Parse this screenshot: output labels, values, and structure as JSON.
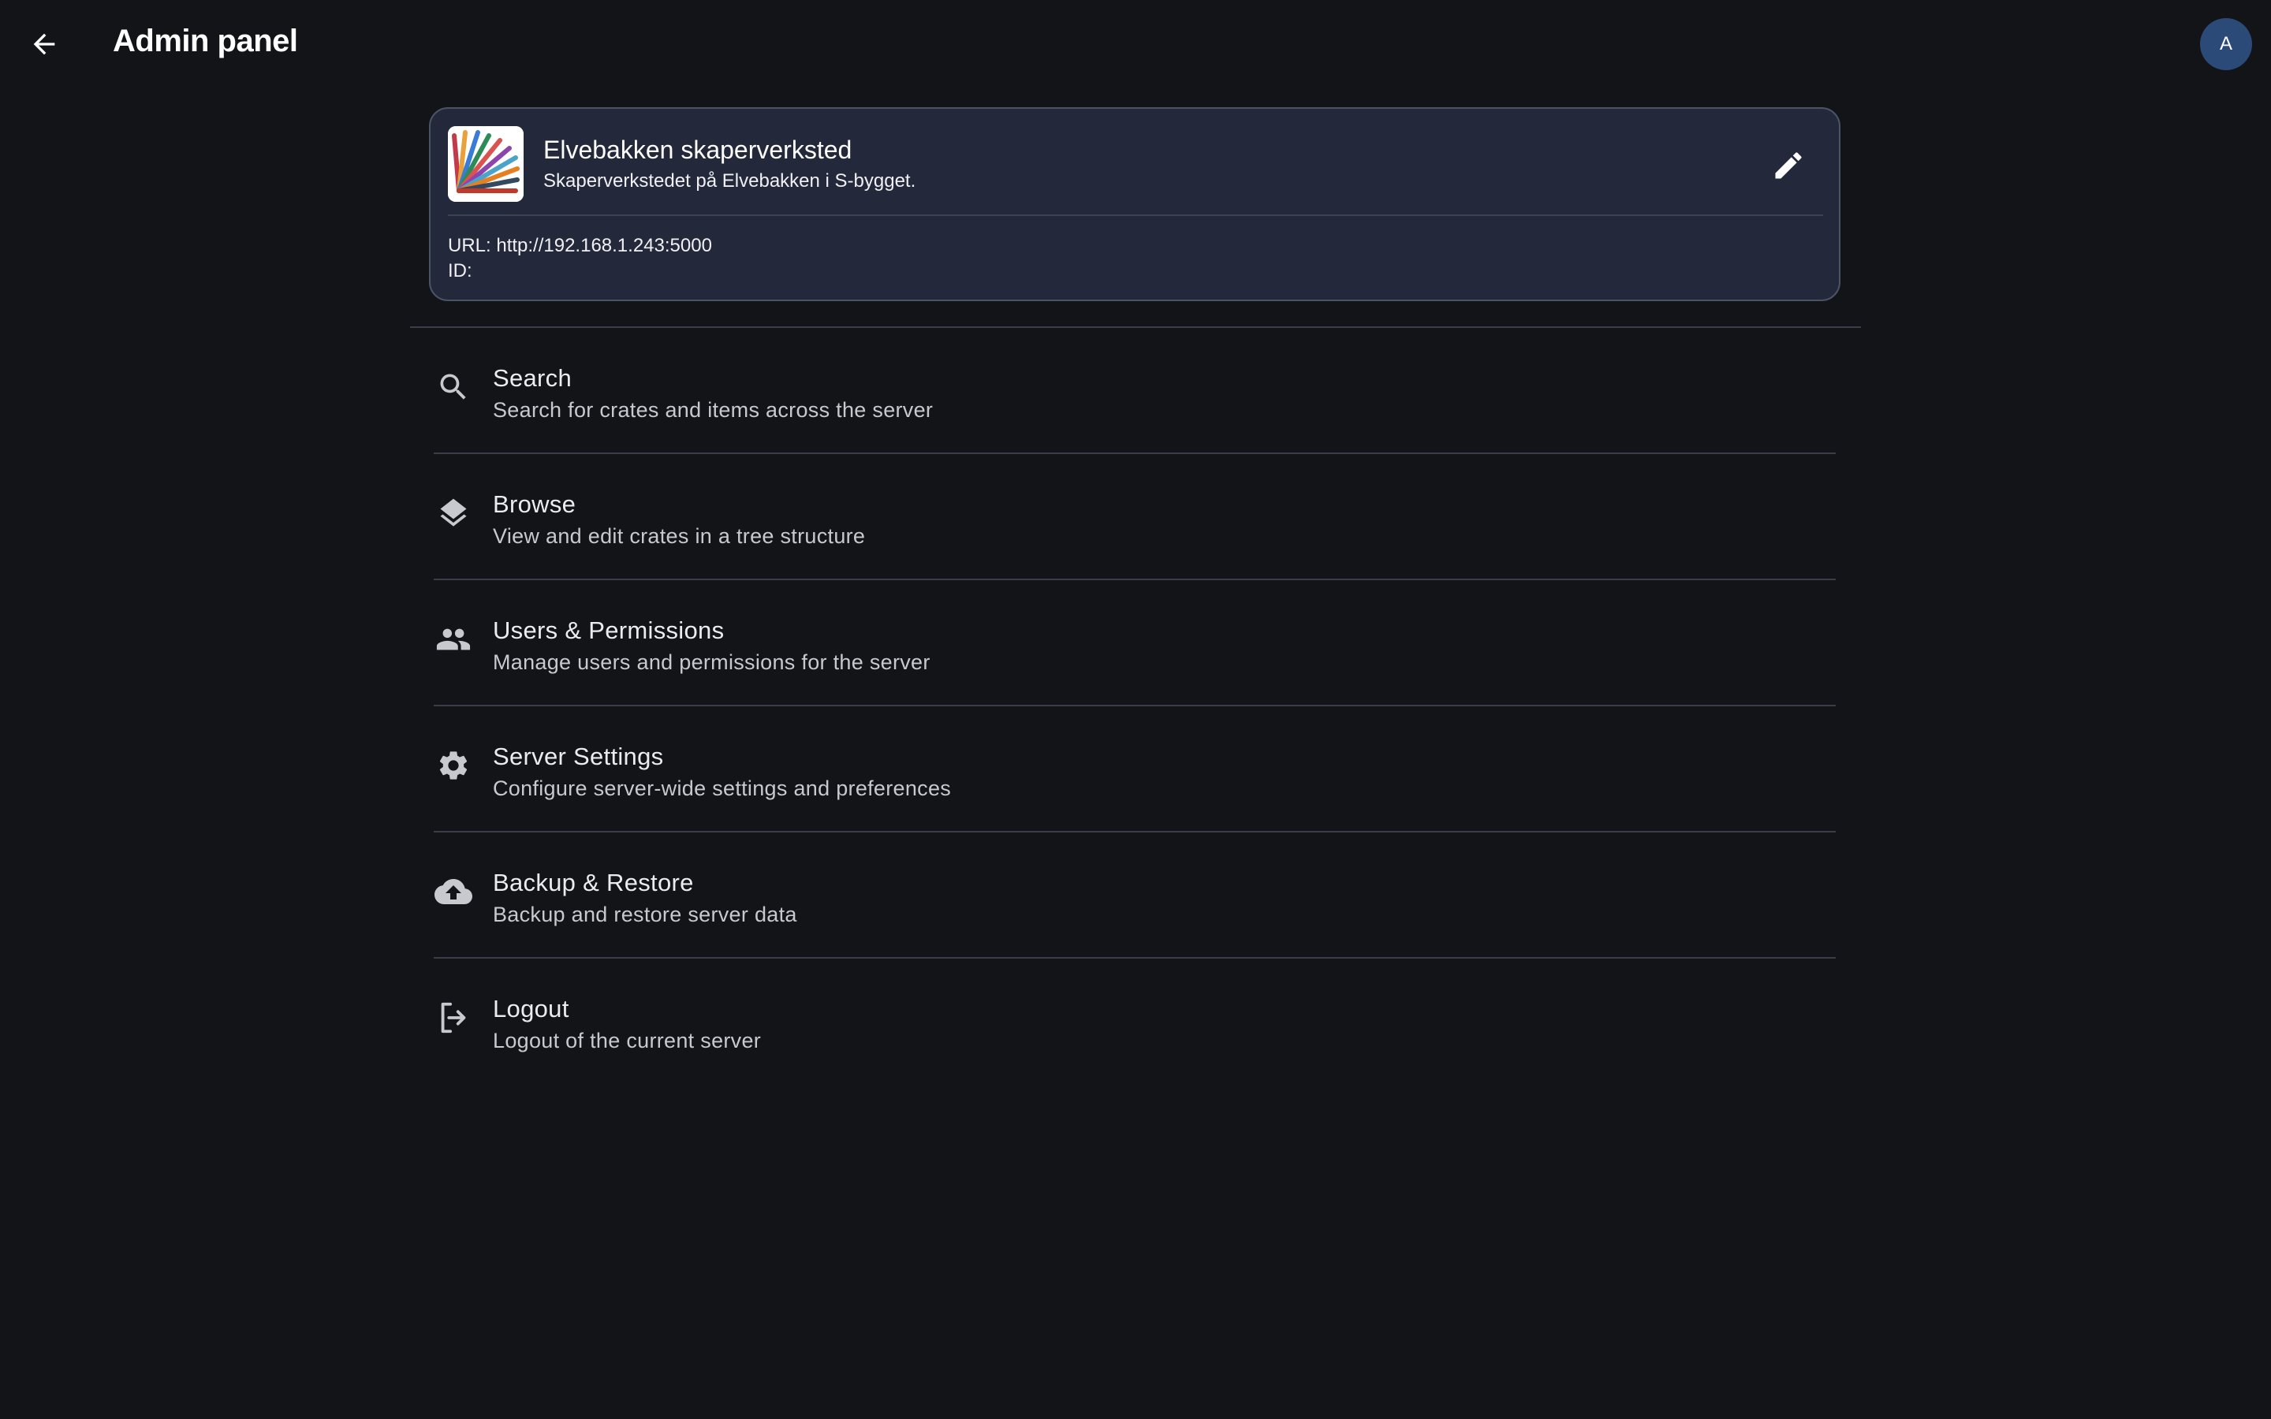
{
  "header": {
    "title": "Admin panel",
    "back_icon": "arrow-left-icon",
    "avatar_initial": "A",
    "avatar_color": "#2b4a78"
  },
  "server": {
    "name": "Elvebakken skaperverksted",
    "description": "Skaperverkstedet på Elvebakken i S-bygget.",
    "url_line": "URL: http://192.168.1.243:5000",
    "id_line": "ID:",
    "edit_icon": "pencil-icon",
    "card_color": "#23283a"
  },
  "menu": {
    "items": [
      {
        "icon": "search-icon",
        "title": "Search",
        "subtitle": "Search for crates and items across the server"
      },
      {
        "icon": "layers-icon",
        "title": "Browse",
        "subtitle": "View and edit crates in a tree structure"
      },
      {
        "icon": "people-icon",
        "title": "Users & Permissions",
        "subtitle": "Manage users and permissions for the server"
      },
      {
        "icon": "gear-icon",
        "title": "Server Settings",
        "subtitle": "Configure server-wide settings and preferences"
      },
      {
        "icon": "cloud-upload-icon",
        "title": "Backup & Restore",
        "subtitle": "Backup and restore server data"
      },
      {
        "icon": "logout-icon",
        "title": "Logout",
        "subtitle": "Logout of the current server"
      }
    ]
  },
  "colors": {
    "background": "#131418",
    "text": "#e4e4e8",
    "divider": "#3a3d45"
  }
}
